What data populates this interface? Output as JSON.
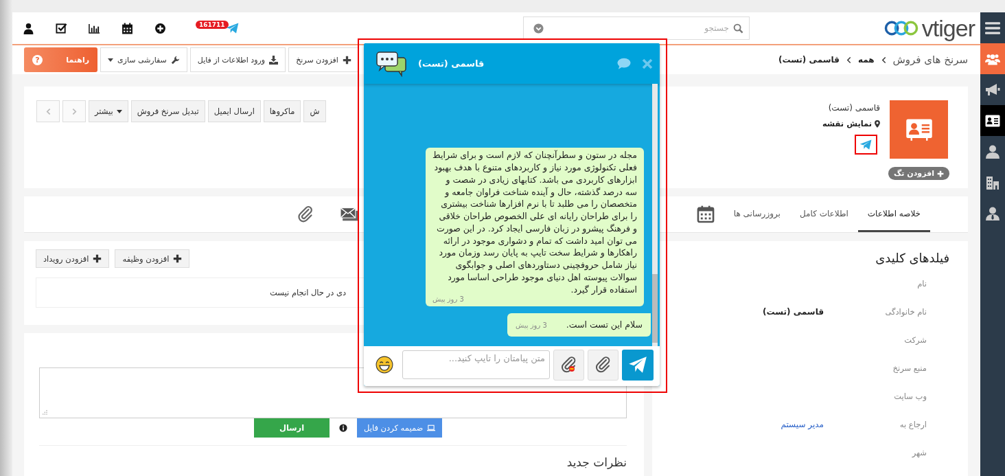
{
  "header": {
    "notification_badge": "161711",
    "search_placeholder": "جستجو",
    "logo": "vtiger"
  },
  "sidebar": {
    "items": [
      {
        "kind": "menu",
        "selected": false
      },
      {
        "kind": "group",
        "selected": false
      },
      {
        "kind": "campaign",
        "selected": false
      },
      {
        "kind": "lead",
        "selected": true
      },
      {
        "kind": "contact",
        "selected": false
      },
      {
        "kind": "organization",
        "selected": false
      },
      {
        "kind": "user",
        "selected": false
      }
    ]
  },
  "actions": [
    {
      "kind": "add",
      "label": "افزودن سرنخ"
    },
    {
      "kind": "import",
      "label": "ورود اطلاعات از فایل"
    },
    {
      "kind": "settings",
      "label": "سفارشی سازی"
    },
    {
      "kind": "help",
      "label": "راهنما",
      "icon_glyph": "?"
    }
  ],
  "breadcrumb": [
    "سرنخ های فروش",
    "همه",
    "قاسمی (تست)"
  ],
  "record": {
    "toolbar": [
      {
        "kind": "text",
        "label": "ش"
      },
      {
        "kind": "text",
        "label": "ماکروها"
      },
      {
        "kind": "text",
        "label": "ارسال ایمیل"
      },
      {
        "kind": "text",
        "label": "تبدیل سرنخ فروش"
      },
      {
        "kind": "menu",
        "label": "بیشتر"
      },
      {
        "kind": "next"
      },
      {
        "kind": "prev"
      }
    ],
    "name": "قاسمی (تست)",
    "map_link": "نمایش نقشه",
    "tag_button": "افزودن تگ"
  },
  "tabs": [
    {
      "label": "خلاصه اطلاعات",
      "selected": true
    },
    {
      "label": "اطلاعات کامل",
      "selected": false
    },
    {
      "label": "بروزرسانی ها",
      "selected": false
    }
  ],
  "activities": {
    "buttons": [
      "افزودن وظیفه",
      "افزودن رویداد"
    ],
    "empty_text": "دی در حال انجام نیست"
  },
  "comments": {
    "send": "ارسال",
    "attach": "ضمیمه کردن فایل",
    "heading": "نظرات جدید"
  },
  "key_fields": {
    "title": "فیلدهای کلیدی",
    "rows": [
      {
        "label": "نام"
      },
      {
        "label": "نام خانوادگی",
        "value": "قاسمی (تست)",
        "kind": "text"
      },
      {
        "label": "شرکت"
      },
      {
        "label": "منبع سرنخ"
      },
      {
        "label": "وب سایت"
      },
      {
        "label": "ارجاع به",
        "value": "مدیر سیستم",
        "kind": "link"
      },
      {
        "label": "شهر"
      }
    ]
  },
  "chat": {
    "title": "قاسمی (تست)",
    "messages": [
      {
        "text": "مجله در ستون و سطرآنچنان که لازم است و برای شرایط فعلی تکنولوژی مورد نیاز و کاربردهای متنوع با هدف بهبود ابزارهای کاربردی می باشد. کتابهای زیادی در شصت و سه درصد گذشته، حال و آینده شناخت فراوان جامعه و متخصصان را می طلبد تا با نرم افزارها شناخت بیشتری را برای طراحان رایانه ای علی الخصوص طراحان خلاقی و فرهنگ پیشرو در زبان فارسی ایجاد کرد. در این صورت می توان امید داشت که تمام و دشواری موجود در ارائه راهکارها و شرایط سخت تایپ به پایان رسد وزمان مورد نیاز شامل حروفچینی دستاوردهای اصلی و جوابگوی سوالات پیوسته اهل دنیای موجود طراحی اساسا مورد استفاده قرار گیرد.",
        "time": "3 روز پیش"
      },
      {
        "text": "سلام این تست است.",
        "time": "3 روز پیش"
      }
    ],
    "input_placeholder": "متن پیامتان را تایپ کنید..."
  }
}
